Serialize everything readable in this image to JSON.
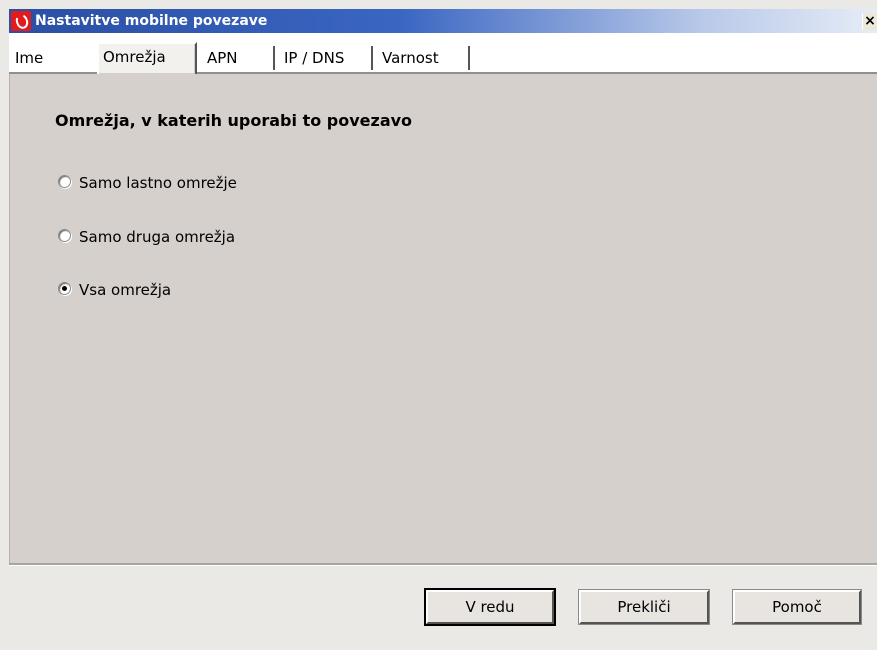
{
  "window": {
    "title": "Nastavitve mobilne povezave",
    "close_symbol": "×"
  },
  "tabs": [
    {
      "label": "Ime",
      "selected": false
    },
    {
      "label": "Omrežja",
      "selected": true
    },
    {
      "label": "APN",
      "selected": false
    },
    {
      "label": "IP / DNS",
      "selected": false
    },
    {
      "label": "Varnost",
      "selected": false
    }
  ],
  "content": {
    "section_title": "Omrežja, v katerih uporabi to povezavo",
    "options": [
      {
        "label": "Samo lastno omrežje",
        "selected": false
      },
      {
        "label": "Samo druga omrežja",
        "selected": false
      },
      {
        "label": "Vsa omrežja",
        "selected": true
      }
    ]
  },
  "buttons": {
    "ok": "V redu",
    "cancel": "Prekliči",
    "help": "Pomoč"
  },
  "icons": {
    "app": "vodafone-logo-icon",
    "close": "close-icon",
    "radio": "radio-icon"
  },
  "colors": {
    "titlebar": "#2a4fa3",
    "panel": "#d5d0cb",
    "app_icon": "#e21c1c"
  }
}
